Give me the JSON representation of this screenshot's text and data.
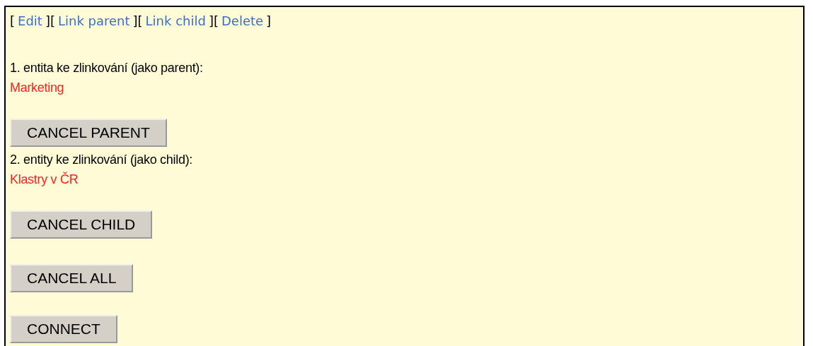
{
  "links": [
    {
      "kind": "bracket",
      "label": "["
    },
    {
      "kind": "link",
      "label": "Edit"
    },
    {
      "kind": "bracket",
      "label": "]["
    },
    {
      "kind": "link",
      "label": "Link parent"
    },
    {
      "kind": "bracket",
      "label": "]["
    },
    {
      "kind": "link",
      "label": "Link child"
    },
    {
      "kind": "bracket",
      "label": "]["
    },
    {
      "kind": "link",
      "label": "Delete"
    },
    {
      "kind": "bracket",
      "label": "]"
    }
  ],
  "entities": [
    {
      "label": "1. entita ke zlinkování (jako parent):",
      "value": "Marketing",
      "button": "CANCEL PARENT"
    },
    {
      "label": "2. entity ke zlinkování (jako child):",
      "value": "Klastry v ČR",
      "button": "CANCEL CHILD"
    }
  ],
  "buttons": [
    "CANCEL ALL",
    "CONNECT"
  ]
}
